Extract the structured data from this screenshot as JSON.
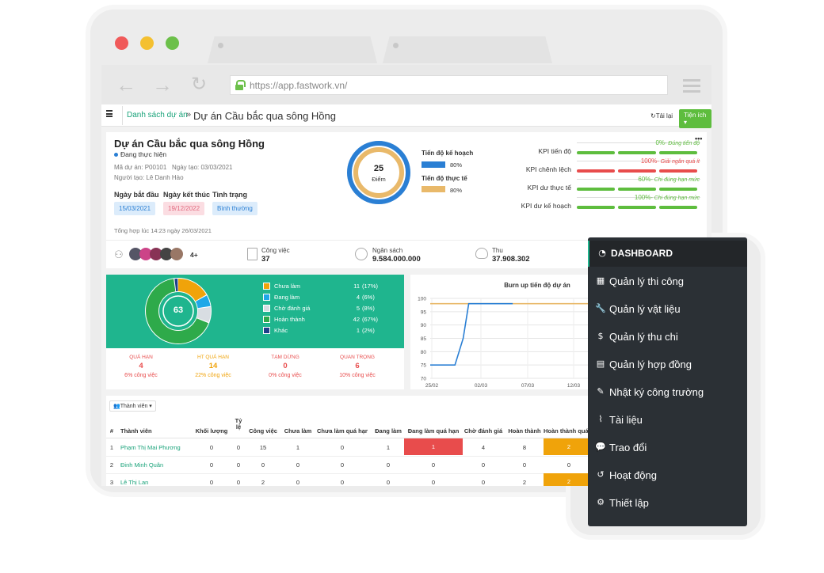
{
  "browser": {
    "url": "https://app.fastwork.vn/"
  },
  "breadcrumb": {
    "link": "Danh sách dự án",
    "separator": "»",
    "title": "Dự án Cầu bắc qua sông Hồng"
  },
  "topbar": {
    "reload_label": "Tải lại",
    "utility_label": "Tiện ích ▾"
  },
  "project": {
    "name": "Dự án Cầu bắc qua sông Hồng",
    "status_line": "Đang thực hiện",
    "code": "Mã dự án: P00101",
    "created": "Ngày tạo: 03/03/2021",
    "creator": "Người tạo: Lê Danh Hào",
    "start_label": "Ngày bắt đầu",
    "end_label": "Ngày kết thúc",
    "state_label": "Tình trạng",
    "start_value": "15/03/2021",
    "end_value": "19/12/2022",
    "state_value": "Bình thường",
    "summary_time": "Tổng hợp lúc 14:23 ngày 26/03/2021",
    "more": "•••"
  },
  "score": {
    "value": "25",
    "label": "Điểm",
    "fraction": 0.25,
    "plan_label": "Tiến độ kế hoạch",
    "plan_pct": "80%",
    "actual_label": "Tiến độ thực tế",
    "actual_pct": "80%",
    "plan_color": "#2a7fd4",
    "actual_color": "#e9b96a"
  },
  "kpis": [
    {
      "label": "KPI tiến độ",
      "pct": "0%",
      "note": "- Đúng tiến độ",
      "color": "#5ebd3e"
    },
    {
      "label": "KPI chênh lệch",
      "pct": "100%",
      "note": "- Giải ngân quá ít",
      "color": "#e84c4c"
    },
    {
      "label": "KPI dư thực tế",
      "pct": "60%",
      "note": "- Chi đúng hạn mức",
      "color": "#5ebd3e"
    },
    {
      "label": "KPI dư kế hoạch",
      "pct": "100%",
      "note": "- Chi đúng hạn mức",
      "color": "#5ebd3e"
    }
  ],
  "stats": {
    "members_more": "4+",
    "work_label": "Công việc",
    "work_value": "37",
    "budget_label": "Ngân sách",
    "budget_value": "9.584.000.000",
    "income_label": "Thu",
    "income_value": "37.908.302"
  },
  "tasks": {
    "total": "63",
    "legend": [
      {
        "label": "Chưa làm",
        "value": "11",
        "pct": "(17%)",
        "color": "#f0a30a",
        "frac": 0.17
      },
      {
        "label": "Đang làm",
        "value": "4",
        "pct": "(6%)",
        "color": "#1ea8e8",
        "frac": 0.06
      },
      {
        "label": "Chờ đánh giá",
        "value": "5",
        "pct": "(8%)",
        "color": "#d8dde2",
        "frac": 0.08
      },
      {
        "label": "Hoàn thành",
        "value": "42",
        "pct": "(67%)",
        "color": "#2eaa4a",
        "frac": 0.67
      },
      {
        "label": "Khác",
        "value": "1",
        "pct": "(2%)",
        "color": "#1f3f8a",
        "frac": 0.02
      }
    ],
    "counters": [
      {
        "label": "QUÁ HẠN",
        "value": "4",
        "sub": "6% công việc",
        "color": "#e84c4c"
      },
      {
        "label": "HT QUÁ HẠN",
        "value": "14",
        "sub": "22% công việc",
        "color": "#f0a30a"
      },
      {
        "label": "TẠM DỪNG",
        "value": "0",
        "sub": "0% công việc",
        "color": "#e84c4c"
      },
      {
        "label": "QUAN TRỌNG",
        "value": "6",
        "sub": "10% công việc",
        "color": "#e84c4c"
      }
    ]
  },
  "chart_data": {
    "type": "line",
    "title": "Burn up tiến độ dự án",
    "xlabel": "",
    "ylabel": "",
    "ylim": [
      70,
      100
    ],
    "yticks": [
      "100",
      "95",
      "90",
      "85",
      "80",
      "75",
      "70"
    ],
    "xticks": [
      "25/02",
      "02/03",
      "07/03",
      "12/03"
    ],
    "grid": true,
    "series": [
      {
        "color": "#e9b96a",
        "points": [
          [
            0,
            98
          ],
          [
            6,
            98
          ],
          [
            20,
            98
          ],
          [
            40,
            98
          ],
          [
            60,
            98
          ],
          [
            64,
            98
          ],
          [
            67,
            91
          ],
          [
            75,
            91
          ],
          [
            100,
            91
          ]
        ]
      },
      {
        "color": "#2a7fd4",
        "points": [
          [
            0,
            75
          ],
          [
            9,
            75
          ],
          [
            12,
            85
          ],
          [
            14,
            98
          ],
          [
            30,
            98
          ]
        ]
      }
    ]
  },
  "members_table": {
    "filter_label": "Thành viên ▾",
    "headers": [
      "#",
      "Thành viên",
      "Khối lượng",
      "Tỷ lệ",
      "Công việc",
      "Chưa làm",
      "Chưa làm quá hạn",
      "Đang làm",
      "Đang làm quá hạn",
      "Chờ đánh giá",
      "Hoàn thành",
      "Hoàn thành quá hạn"
    ],
    "rows": [
      [
        "1",
        "Phạm Thị Mai Phương",
        "0",
        "0",
        "15",
        "1",
        "0",
        "1",
        "1",
        "4",
        "8",
        "2"
      ],
      [
        "2",
        "Đinh Minh Quân",
        "0",
        "0",
        "0",
        "0",
        "0",
        "0",
        "0",
        "0",
        "0",
        "0"
      ],
      [
        "3",
        "Lê Thị Lan",
        "0",
        "0",
        "2",
        "0",
        "0",
        "0",
        "0",
        "0",
        "2",
        "2"
      ]
    ]
  },
  "sidebar": {
    "items": [
      {
        "label": "DASHBOARD",
        "icon": "dashboard-icon",
        "glyph": "◔"
      },
      {
        "label": "Quản lý thi công",
        "icon": "table-icon",
        "glyph": "▦"
      },
      {
        "label": "Quản lý vật liệu",
        "icon": "wrench-icon",
        "glyph": "🔧"
      },
      {
        "label": "Quản lý thu chi",
        "icon": "dollar-icon",
        "glyph": "$"
      },
      {
        "label": "Quản lý hợp đồng",
        "icon": "document-icon",
        "glyph": "▤"
      },
      {
        "label": "Nhật ký công trường",
        "icon": "edit-icon",
        "glyph": "✎"
      },
      {
        "label": "Tài liệu",
        "icon": "paperclip-icon",
        "glyph": "⌇"
      },
      {
        "label": "Trao đổi",
        "icon": "comments-icon",
        "glyph": "💬"
      },
      {
        "label": "Hoạt động",
        "icon": "history-icon",
        "glyph": "↺"
      },
      {
        "label": "Thiết lập",
        "icon": "gear-icon",
        "glyph": "⚙"
      }
    ]
  }
}
